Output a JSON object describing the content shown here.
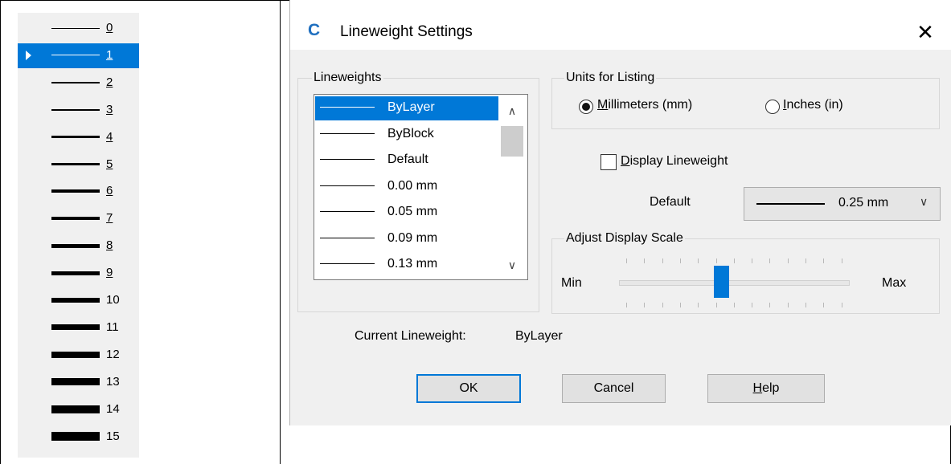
{
  "left_panel": {
    "rows": [
      {
        "num": "0",
        "thickness": 1,
        "underline": true
      },
      {
        "num": "1",
        "thickness": 1,
        "underline": true,
        "selected": true
      },
      {
        "num": "2",
        "thickness": 2,
        "underline": true
      },
      {
        "num": "3",
        "thickness": 2,
        "underline": true
      },
      {
        "num": "4",
        "thickness": 3,
        "underline": true
      },
      {
        "num": "5",
        "thickness": 3,
        "underline": true
      },
      {
        "num": "6",
        "thickness": 4,
        "underline": true
      },
      {
        "num": "7",
        "thickness": 4,
        "underline": true
      },
      {
        "num": "8",
        "thickness": 5,
        "underline": true
      },
      {
        "num": "9",
        "thickness": 5,
        "underline": true
      },
      {
        "num": "10",
        "thickness": 6,
        "underline": false
      },
      {
        "num": "11",
        "thickness": 7,
        "underline": false
      },
      {
        "num": "12",
        "thickness": 8,
        "underline": false
      },
      {
        "num": "13",
        "thickness": 9,
        "underline": false
      },
      {
        "num": "14",
        "thickness": 10,
        "underline": false
      },
      {
        "num": "15",
        "thickness": 11,
        "underline": false
      }
    ]
  },
  "dialog": {
    "icon": "C",
    "title": "Lineweight Settings",
    "close_label": "✕",
    "lineweights_legend": "Lineweights",
    "lineweights": [
      "ByLayer",
      "ByBlock",
      "Default",
      "0.00 mm",
      "0.05 mm",
      "0.09 mm",
      "0.13 mm"
    ],
    "units_legend": "Units for Listing",
    "mm_label": "Millimeters (mm)",
    "inch_label": "Inches (in)",
    "display_lineweight_label": "Display Lineweight",
    "default_label": "Default",
    "default_value": "0.25 mm",
    "adjust_legend": "Adjust Display Scale",
    "min_label": "Min",
    "max_label": "Max",
    "slider_level": 0.45,
    "current_label": "Current Lineweight:",
    "current_value": "ByLayer",
    "ok_label": "OK",
    "cancel_label": "Cancel",
    "help_label": "Help"
  }
}
